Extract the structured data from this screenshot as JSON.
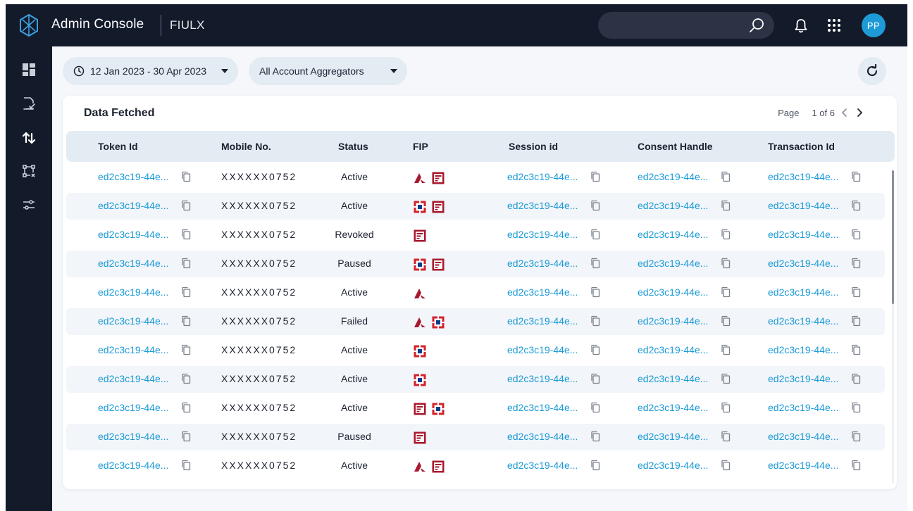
{
  "app": {
    "title": "Admin Console",
    "org": "FIULX"
  },
  "search": {
    "placeholder": "",
    "value": ""
  },
  "user": {
    "initials": "PP"
  },
  "sidebar": {
    "items": [
      {
        "name": "dashboard-icon"
      },
      {
        "name": "document-check-icon"
      },
      {
        "name": "transfer-arrows-icon"
      },
      {
        "name": "flow-diagram-icon"
      },
      {
        "name": "settings-sliders-icon"
      }
    ]
  },
  "filters": {
    "date_range": "12 Jan 2023 - 30 Apr 2023",
    "aggregator": "All Account Aggregators"
  },
  "card": {
    "title": "Data Fetched",
    "page_label": "Page",
    "page_value": "1 of 6"
  },
  "table": {
    "columns": [
      "Token Id",
      "Mobile No.",
      "Status",
      "FIP",
      "Session id",
      "Consent Handle",
      "Transaction Id"
    ],
    "rows": [
      {
        "token": "ed2c3c19-44e...",
        "mobile": "XXXXXX0752",
        "status": "Active",
        "fip": [
          "axis",
          "bank"
        ],
        "session": "ed2c3c19-44e...",
        "consent": "ed2c3c19-44e...",
        "txn": "ed2c3c19-44e..."
      },
      {
        "token": "ed2c3c19-44e...",
        "mobile": "XXXXXX0752",
        "status": "Active",
        "fip": [
          "hdfc",
          "bank"
        ],
        "session": "ed2c3c19-44e...",
        "consent": "ed2c3c19-44e...",
        "txn": "ed2c3c19-44e..."
      },
      {
        "token": "ed2c3c19-44e...",
        "mobile": "XXXXXX0752",
        "status": "Revoked",
        "fip": [
          "bank"
        ],
        "session": "ed2c3c19-44e...",
        "consent": "ed2c3c19-44e...",
        "txn": "ed2c3c19-44e..."
      },
      {
        "token": "ed2c3c19-44e...",
        "mobile": "XXXXXX0752",
        "status": "Paused",
        "fip": [
          "hdfc",
          "bank"
        ],
        "session": "ed2c3c19-44e...",
        "consent": "ed2c3c19-44e...",
        "txn": "ed2c3c19-44e..."
      },
      {
        "token": "ed2c3c19-44e...",
        "mobile": "XXXXXX0752",
        "status": "Active",
        "fip": [
          "axis"
        ],
        "session": "ed2c3c19-44e...",
        "consent": "ed2c3c19-44e...",
        "txn": "ed2c3c19-44e..."
      },
      {
        "token": "ed2c3c19-44e...",
        "mobile": "XXXXXX0752",
        "status": "Failed",
        "fip": [
          "axis",
          "hdfc"
        ],
        "session": "ed2c3c19-44e...",
        "consent": "ed2c3c19-44e...",
        "txn": "ed2c3c19-44e..."
      },
      {
        "token": "ed2c3c19-44e...",
        "mobile": "XXXXXX0752",
        "status": "Active",
        "fip": [
          "hdfc"
        ],
        "session": "ed2c3c19-44e...",
        "consent": "ed2c3c19-44e...",
        "txn": "ed2c3c19-44e..."
      },
      {
        "token": "ed2c3c19-44e...",
        "mobile": "XXXXXX0752",
        "status": "Active",
        "fip": [
          "hdfc"
        ],
        "session": "ed2c3c19-44e...",
        "consent": "ed2c3c19-44e...",
        "txn": "ed2c3c19-44e..."
      },
      {
        "token": "ed2c3c19-44e...",
        "mobile": "XXXXXX0752",
        "status": "Active",
        "fip": [
          "bank",
          "hdfc"
        ],
        "session": "ed2c3c19-44e...",
        "consent": "ed2c3c19-44e...",
        "txn": "ed2c3c19-44e..."
      },
      {
        "token": "ed2c3c19-44e...",
        "mobile": "XXXXXX0752",
        "status": "Paused",
        "fip": [
          "bank"
        ],
        "session": "ed2c3c19-44e...",
        "consent": "ed2c3c19-44e...",
        "txn": "ed2c3c19-44e..."
      },
      {
        "token": "ed2c3c19-44e...",
        "mobile": "XXXXXX0752",
        "status": "Active",
        "fip": [
          "axis",
          "bank"
        ],
        "session": "ed2c3c19-44e...",
        "consent": "ed2c3c19-44e...",
        "txn": "ed2c3c19-44e..."
      }
    ]
  },
  "colors": {
    "topbar": "#131a2a",
    "link": "#1a9ad6",
    "header_bg": "#e3ebf3",
    "avatar": "#1e9bd7",
    "fip_red": "#a8192e",
    "fip_blue": "#0a3b8c"
  }
}
